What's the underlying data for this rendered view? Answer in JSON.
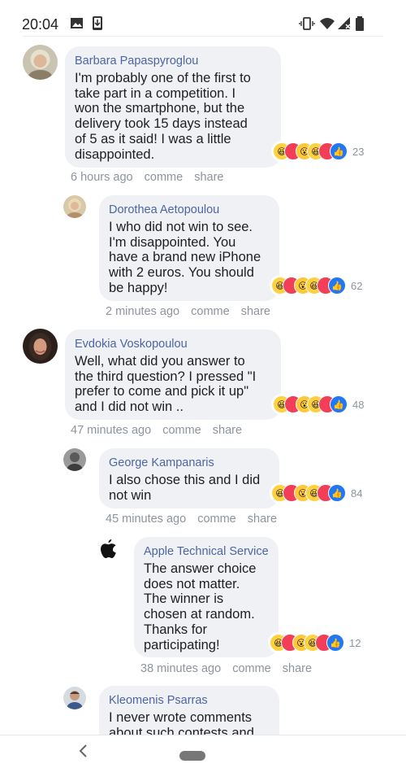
{
  "status_bar": {
    "time": "20:04",
    "left_icons": [
      "image-icon",
      "download-icon"
    ],
    "right_icons": [
      "vibrate-icon",
      "wifi-icon",
      "signal-icon",
      "battery-icon"
    ]
  },
  "comments": [
    {
      "author": "Barbara Papaspyroglou",
      "text_lines": [
        "I'm probably one of the first to",
        "take part in a competition. I",
        "won the smartphone, but the",
        "delivery took 15 days instead",
        "of 5 as it said! I was a little",
        "disappointed."
      ],
      "reaction_count": "23",
      "time": "6 hours ago",
      "action_reply": "comme",
      "action_share": "share"
    },
    {
      "author": "Dorothea Aetopoulou",
      "text_lines": [
        "I who did not win to see.",
        "I'm disappointed. You",
        "have a brand new iPhone",
        "with 2 euros. You should",
        "be happy!"
      ],
      "reaction_count": "62",
      "time": "2 minutes ago",
      "action_reply": "comme",
      "action_share": "share"
    },
    {
      "author": "Evdokia Voskopoulou",
      "text_lines": [
        "Well, what did you answer to",
        "the third question? I pressed \"I",
        "prefer to come and pick it up\"",
        "and I did not win .."
      ],
      "reaction_count": "48",
      "time": "47 minutes ago",
      "action_reply": "comme",
      "action_share": "share"
    },
    {
      "author": "George Kampanaris",
      "text_lines": [
        "I also chose this and I did",
        "not win"
      ],
      "reaction_count": "84",
      "time": "45 minutes ago",
      "action_reply": "comme",
      "action_share": "share"
    },
    {
      "author": "Apple Technical Service",
      "text_lines": [
        "The answer choice",
        "does not matter.",
        "The winner is",
        "chosen at random.",
        "Thanks for",
        "participating!"
      ],
      "reaction_count": "12",
      "time": "38 minutes ago",
      "action_reply": "comme",
      "action_share": "share"
    },
    {
      "author": "Kleomenis Psarras",
      "text_lines": [
        "I never wrote comments",
        "about such contests and"
      ]
    }
  ],
  "reaction_icons": [
    "haha-icon",
    "love-icon",
    "wow-icon",
    "haha-icon",
    "love-icon",
    "like-icon"
  ],
  "nav": {
    "back_icon": "chevron-left-icon",
    "home_icon": "home-pill-icon"
  },
  "colors": {
    "bubble": "#f0f1f5",
    "author": "#4b66a0",
    "meta": "#8d949e",
    "like": "#2078f4",
    "love": "#f33e58",
    "haha": "#ffd140"
  }
}
